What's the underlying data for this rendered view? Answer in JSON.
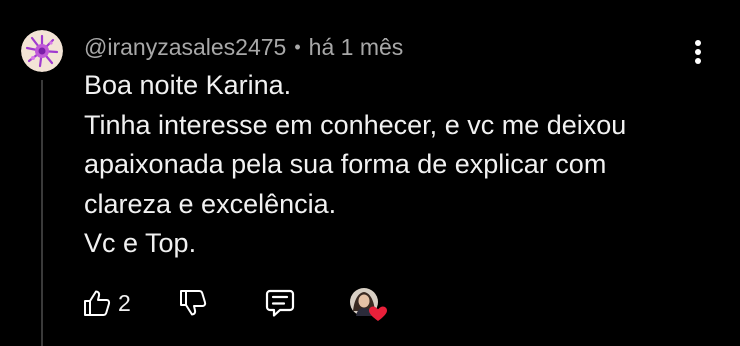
{
  "comment": {
    "author": "@iranyzasales2475",
    "separator": "•",
    "timestamp": "há 1 mês",
    "lines": [
      "Boa noite Karina.",
      "Tinha interesse em conhecer, e vc me deixou",
      "apaixonada pela sua forma de explicar com",
      "clareza e excelência.",
      "Vc e Top."
    ],
    "like_count": "2"
  },
  "icons": {
    "like": "thumbs-up-icon",
    "dislike": "thumbs-down-icon",
    "reply": "reply-comment-icon",
    "menu": "more-vertical-icon",
    "creator_heart": "creator-heart-icon"
  },
  "colors": {
    "background": "#000000",
    "meta_text": "#a8a8a8",
    "body_text": "#f1f1f1",
    "heart": "#e8203a",
    "avatar_bg": "#f3e4d6",
    "avatar_accent": "#a03ad0"
  }
}
